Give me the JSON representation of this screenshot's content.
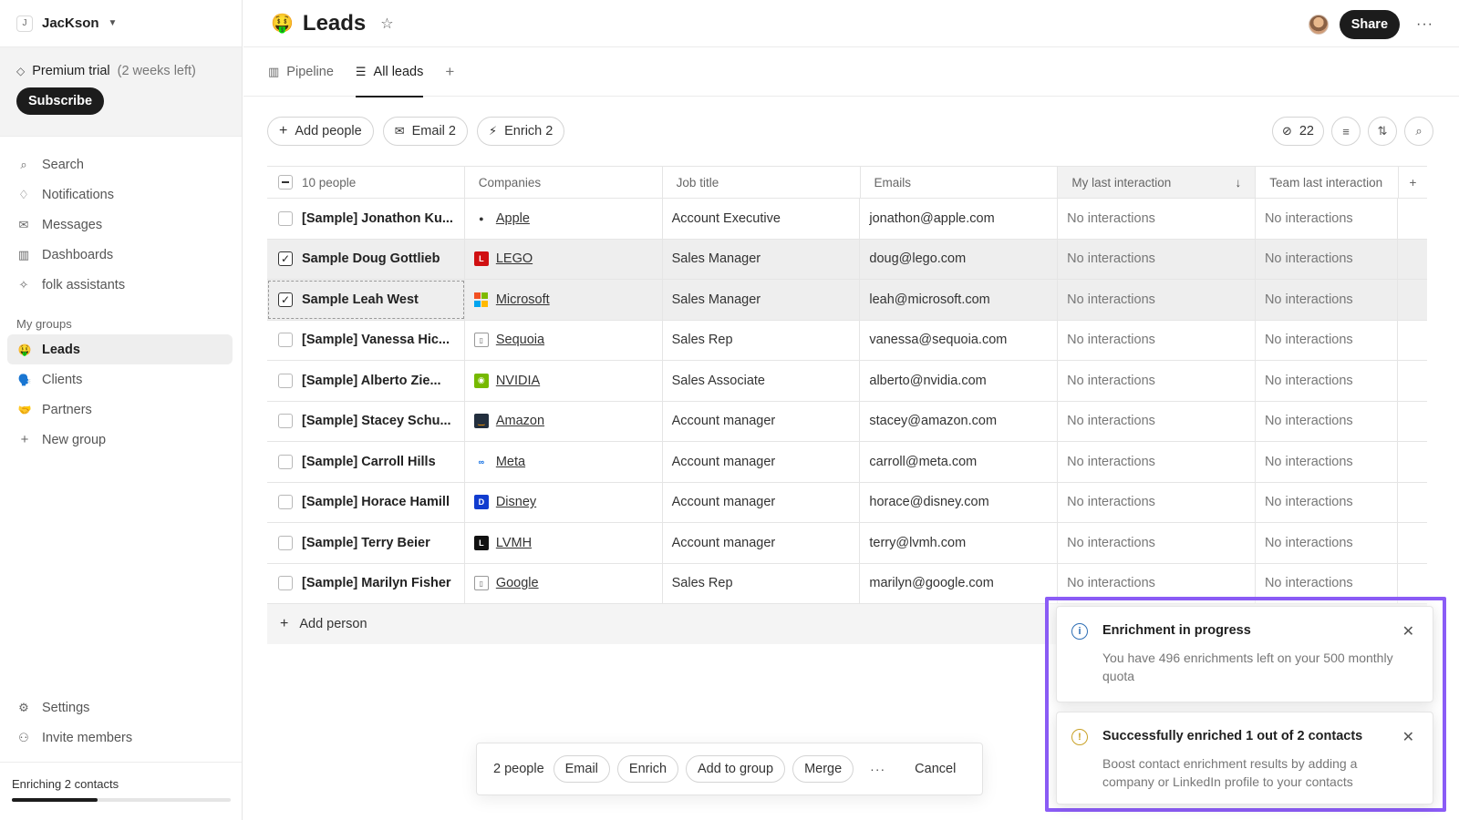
{
  "workspace": {
    "initial": "J",
    "name": "JacKson"
  },
  "trial": {
    "label": "Premium trial",
    "remaining": "(2 weeks left)",
    "subscribe_label": "Subscribe"
  },
  "nav": [
    {
      "label": "Search",
      "icon": "search-icon"
    },
    {
      "label": "Notifications",
      "icon": "bell-icon"
    },
    {
      "label": "Messages",
      "icon": "mail-icon"
    },
    {
      "label": "Dashboards",
      "icon": "chart-icon"
    },
    {
      "label": "folk assistants",
      "icon": "sparkle-icon"
    }
  ],
  "groups": {
    "title": "My groups",
    "items": [
      {
        "label": "Leads",
        "emoji": "🤑",
        "active": true
      },
      {
        "label": "Clients",
        "emoji": "🗣️"
      },
      {
        "label": "Partners",
        "emoji": "🤝"
      }
    ],
    "new_label": "New group"
  },
  "bottom_nav": [
    {
      "label": "Settings",
      "icon": "gear-icon"
    },
    {
      "label": "Invite members",
      "icon": "user-plus-icon"
    }
  ],
  "enriching": {
    "label": "Enriching 2 contacts",
    "progress": 0.39
  },
  "page": {
    "emoji": "🤑",
    "title": "Leads",
    "share_label": "Share"
  },
  "tabs": [
    {
      "label": "Pipeline",
      "icon": "columns-icon"
    },
    {
      "label": "All leads",
      "icon": "table-icon",
      "active": true
    }
  ],
  "toolbar": {
    "add_people": "Add people",
    "email": "Email 2",
    "enrich": "Enrich 2",
    "hidden_count": "22"
  },
  "table": {
    "columns": [
      "10 people",
      "Companies",
      "Job title",
      "Emails",
      "My last interaction",
      "Team last interaction"
    ],
    "rows": [
      {
        "name": "[Sample] Jonathon Ku...",
        "company": "Apple",
        "logo": "",
        "job": "Account Executive",
        "email": "jonathon@apple.com",
        "my": "No interactions",
        "team": "No interactions",
        "checked": false
      },
      {
        "name": "Sample Doug Gottlieb",
        "company": "LEGO",
        "logo": "LEGO",
        "job": "Sales Manager",
        "email": "doug@lego.com",
        "my": "No interactions",
        "team": "No interactions",
        "checked": true
      },
      {
        "name": "Sample Leah West",
        "company": "Microsoft",
        "logo": "",
        "job": "Sales Manager",
        "email": "leah@microsoft.com",
        "my": "No interactions",
        "team": "No interactions",
        "checked": true
      },
      {
        "name": "[Sample] Vanessa Hic...",
        "company": "Sequoia",
        "logo": "",
        "job": "Sales Rep",
        "email": "vanessa@sequoia.com",
        "my": "No interactions",
        "team": "No interactions",
        "checked": false
      },
      {
        "name": "[Sample] Alberto Zie...",
        "company": "NVIDIA",
        "logo": "",
        "job": "Sales Associate",
        "email": "alberto@nvidia.com",
        "my": "No interactions",
        "team": "No interactions",
        "checked": false
      },
      {
        "name": "[Sample] Stacey Schu...",
        "company": "Amazon",
        "logo": "",
        "job": "Account manager",
        "email": "stacey@amazon.com",
        "my": "No interactions",
        "team": "No interactions",
        "checked": false
      },
      {
        "name": "[Sample] Carroll Hills",
        "company": "Meta",
        "logo": "∞",
        "job": "Account manager",
        "email": "carroll@meta.com",
        "my": "No interactions",
        "team": "No interactions",
        "checked": false
      },
      {
        "name": "[Sample] Horace Hamill",
        "company": "Disney",
        "logo": "",
        "job": "Account manager",
        "email": "horace@disney.com",
        "my": "No interactions",
        "team": "No interactions",
        "checked": false
      },
      {
        "name": "[Sample] Terry Beier",
        "company": "LVMH",
        "logo": "",
        "job": "Account manager",
        "email": "terry@lvmh.com",
        "my": "No interactions",
        "team": "No interactions",
        "checked": false
      },
      {
        "name": "[Sample] Marilyn Fisher",
        "company": "Google",
        "logo": "",
        "job": "Sales Rep",
        "email": "marilyn@google.com",
        "my": "No interactions",
        "team": "No interactions",
        "checked": false
      }
    ],
    "add_person": "Add person"
  },
  "bulk": {
    "count": "2 people",
    "email": "Email",
    "enrich": "Enrich",
    "add_to_group": "Add to group",
    "merge": "Merge",
    "more": "···",
    "cancel": "Cancel"
  },
  "toasts": [
    {
      "title": "Enrichment in progress",
      "body": "You have 496 enrichments left on your 500 monthly quota",
      "icon": "info-icon",
      "color": "#2f6fb5"
    },
    {
      "title": "Successfully enriched 1 out of 2 contacts",
      "body": "Boost contact enrichment results by adding a company or LinkedIn profile to your contacts",
      "icon": "warning-icon",
      "color": "#c9a227"
    }
  ],
  "colors": {
    "accent": "#1c1c1c",
    "highlight": "#8b5cf6"
  }
}
